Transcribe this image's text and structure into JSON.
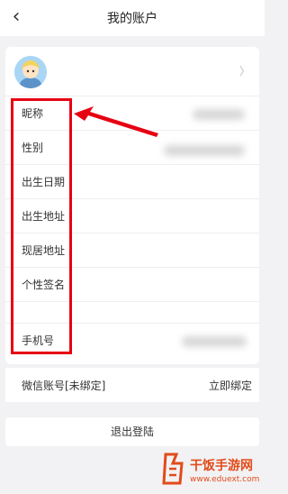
{
  "header": {
    "back_icon": "chevron-left-icon",
    "title": "我的账户"
  },
  "profile": {
    "avatar_icon": "avatar",
    "chevron": "〉",
    "rows": [
      {
        "label": "昵称"
      },
      {
        "label": "性别"
      },
      {
        "label": "出生日期"
      },
      {
        "label": "出生地址"
      },
      {
        "label": "现居地址"
      },
      {
        "label": "个性签名"
      },
      {
        "label": ""
      },
      {
        "label": "手机号"
      }
    ]
  },
  "wechat": {
    "label": "微信账号[未绑定]",
    "action": "立即绑定"
  },
  "logout_label": "退出登陆",
  "watermark": {
    "text": "干饭手游网",
    "url": "www.eduext.com"
  },
  "colors": {
    "annotation": "#e60012",
    "watermark": "#e24b1a"
  }
}
